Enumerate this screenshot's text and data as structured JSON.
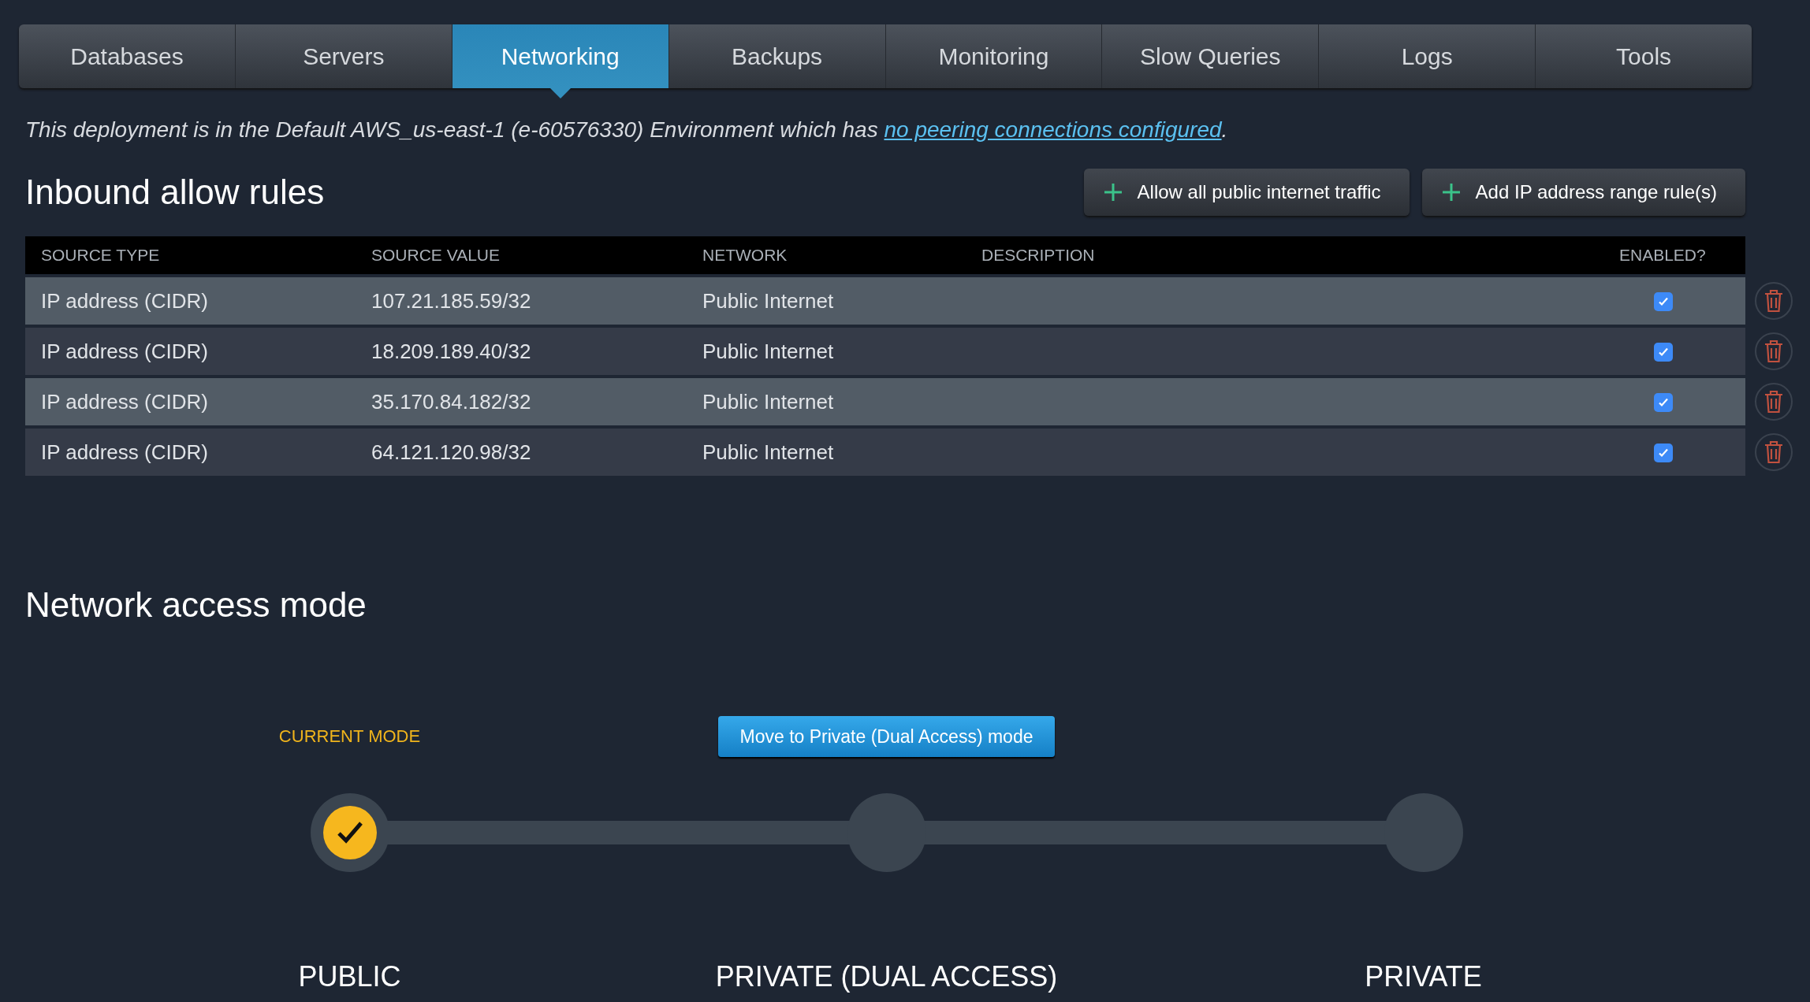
{
  "tabs": [
    {
      "label": "Databases",
      "selected": false
    },
    {
      "label": "Servers",
      "selected": false
    },
    {
      "label": "Networking",
      "selected": true
    },
    {
      "label": "Backups",
      "selected": false
    },
    {
      "label": "Monitoring",
      "selected": false
    },
    {
      "label": "Slow Queries",
      "selected": false
    },
    {
      "label": "Logs",
      "selected": false
    },
    {
      "label": "Tools",
      "selected": false
    }
  ],
  "notice": {
    "text": "This deployment is in the Default AWS_us-east-1 (e-60576330) Environment which has ",
    "link": "no peering connections configured",
    "end": "."
  },
  "inbound": {
    "title": "Inbound allow rules",
    "buttons": [
      "Allow all public internet traffic",
      "Add IP address range rule(s)"
    ],
    "columns": [
      "SOURCE TYPE",
      "SOURCE VALUE",
      "NETWORK",
      "DESCRIPTION",
      "ENABLED?"
    ],
    "rows": [
      {
        "source_type": "IP address (CIDR)",
        "source_value": "107.21.185.59/32",
        "network": "Public Internet",
        "enabled": true
      },
      {
        "source_type": "IP address (CIDR)",
        "source_value": "18.209.189.40/32",
        "network": "Public Internet",
        "enabled": true
      },
      {
        "source_type": "IP address (CIDR)",
        "source_value": "35.170.84.182/32",
        "network": "Public Internet",
        "enabled": true
      },
      {
        "source_type": "IP address (CIDR)",
        "source_value": "64.121.120.98/32",
        "network": "Public Internet",
        "enabled": true
      }
    ]
  },
  "access_mode": {
    "title": "Network access mode",
    "current_label": "CURRENT MODE",
    "modes": [
      {
        "label": "PUBLIC",
        "selected": true
      },
      {
        "label": "PRIVATE (DUAL ACCESS)",
        "selected": false,
        "action": "Move to Private (Dual Access) mode"
      },
      {
        "label": "PRIVATE",
        "selected": false
      }
    ]
  }
}
